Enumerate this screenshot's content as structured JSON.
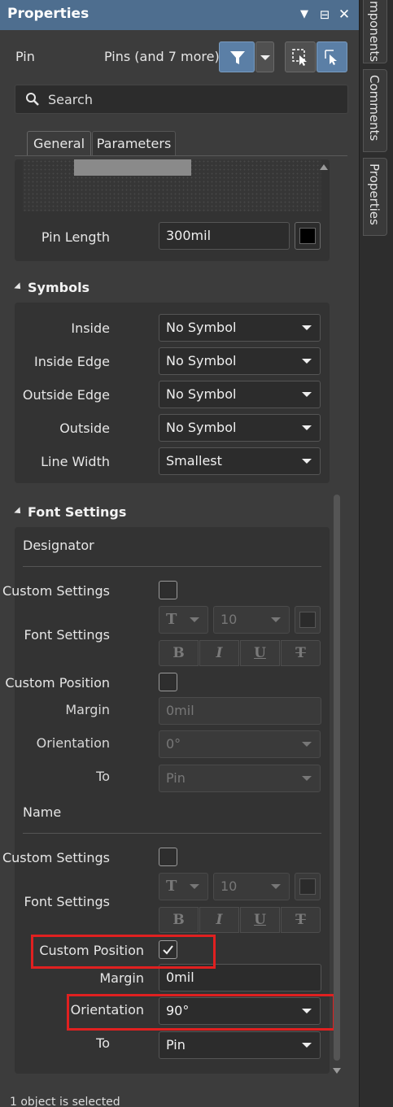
{
  "titlebar": {
    "title": "Properties",
    "menu_glyph": "▼",
    "pin_glyph": "⊟",
    "close_glyph": "✕"
  },
  "side_tabs": [
    "mponents",
    "Comments",
    "Properties"
  ],
  "header": {
    "object_label": "Pin",
    "filter_label": "Pins (and 7 more)"
  },
  "search": {
    "placeholder": "Search"
  },
  "tabs": [
    {
      "label": "General",
      "active": true
    },
    {
      "label": "Parameters",
      "active": false
    }
  ],
  "pin_length": {
    "label": "Pin Length",
    "value": "300mil"
  },
  "symbols": {
    "title": "Symbols",
    "rows": [
      {
        "label": "Inside",
        "value": "No Symbol"
      },
      {
        "label": "Inside Edge",
        "value": "No Symbol"
      },
      {
        "label": "Outside Edge",
        "value": "No Symbol"
      },
      {
        "label": "Outside",
        "value": "No Symbol"
      },
      {
        "label": "Line Width",
        "value": "Smallest"
      }
    ]
  },
  "font_settings": {
    "title": "Font Settings",
    "designator": {
      "title": "Designator",
      "custom_settings_label": "Custom Settings",
      "custom_settings_checked": false,
      "font_settings_label": "Font Settings",
      "font_size": "10",
      "format_buttons": [
        "B",
        "I",
        "U",
        "T"
      ],
      "custom_position_label": "Custom Position",
      "custom_position_checked": false,
      "margin_label": "Margin",
      "margin_value": "0mil",
      "orientation_label": "Orientation",
      "orientation_value": "0°",
      "to_label": "To",
      "to_value": "Pin"
    },
    "name": {
      "title": "Name",
      "custom_settings_label": "Custom Settings",
      "custom_settings_checked": false,
      "font_settings_label": "Font Settings",
      "font_size": "10",
      "format_buttons": [
        "B",
        "I",
        "U",
        "T"
      ],
      "custom_position_label": "Custom Position",
      "custom_position_checked": true,
      "margin_label": "Margin",
      "margin_value": "0mil",
      "orientation_label": "Orientation",
      "orientation_value": "90°",
      "to_label": "To",
      "to_value": "Pin"
    }
  },
  "status": {
    "text": "1 object is selected"
  },
  "colors": {
    "titlebar": "#4e6e8f",
    "accent_button": "#5b7fa6",
    "highlight": "#e02020",
    "panel": "#3c3c3c"
  }
}
